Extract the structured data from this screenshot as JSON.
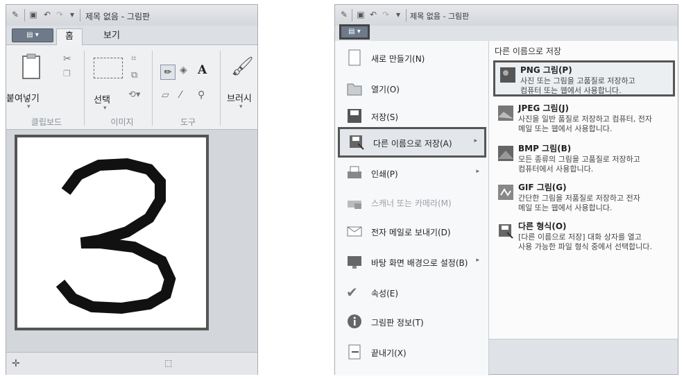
{
  "left_window": {
    "title": "제목 없음 - 그림판",
    "tabs": [
      "홈",
      "보기"
    ],
    "groups": {
      "clipboard": {
        "label": "클립보드",
        "paste": "붙여넣기"
      },
      "image": {
        "label": "이미지",
        "select": "선택"
      },
      "tools": {
        "label": "도구"
      },
      "brush": "브러시"
    }
  },
  "right_window": {
    "title": "제목 없음 - 그림판",
    "menu_items": [
      {
        "label": "새로 만들기(N)"
      },
      {
        "label": "열기(O)"
      },
      {
        "label": "저장(S)"
      },
      {
        "label": "다른 이름으로 저장(A)"
      },
      {
        "label": "인쇄(P)"
      },
      {
        "label": "스캐너 또는 카메라(M)"
      },
      {
        "label": "전자 메일로 보내기(D)"
      },
      {
        "label": "바탕 화면 배경으로 설정(B)"
      },
      {
        "label": "속성(E)"
      },
      {
        "label": "그림판 정보(T)"
      },
      {
        "label": "끝내기(X)"
      }
    ],
    "submenu": {
      "heading": "다른 이름으로 저장",
      "items": [
        {
          "name": "PNG 그림(P)",
          "desc1": "사진 또는 그림을 고품질로 저장하고",
          "desc2": "컴퓨터 또는 웹에서 사용합니다."
        },
        {
          "name": "JPEG 그림(J)",
          "desc1": "사진을 일반 품질로 저장하고 컴퓨터, 전자",
          "desc2": "메일 또는 웹에서 사용합니다."
        },
        {
          "name": "BMP 그림(B)",
          "desc1": "모든 종류의 그림을 고품질로 저장하고",
          "desc2": "컴퓨터에서 사용합니다."
        },
        {
          "name": "GIF 그림(G)",
          "desc1": "간단한 그림을 저품질로 저장하고 전자",
          "desc2": "메일 또는 웹에서 사용합니다."
        },
        {
          "name": "다른 형식(O)",
          "desc1": "[다른 이름으로 저장] 대화 상자를 열고",
          "desc2": "사용 가능한 파일 형식 중에서 선택합니다."
        }
      ]
    }
  }
}
